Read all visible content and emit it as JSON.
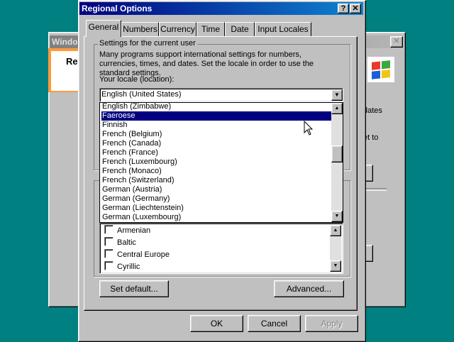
{
  "background_window": {
    "title": "Windo",
    "heading": "Re",
    "close_glyph": "✕",
    "side_text_1": "dates",
    "side_text_2": "et to"
  },
  "dialog": {
    "title": "Regional Options",
    "help_glyph": "?",
    "close_glyph": "✕"
  },
  "tabs": [
    {
      "label": "General",
      "active": true
    },
    {
      "label": "Numbers"
    },
    {
      "label": "Currency"
    },
    {
      "label": "Time"
    },
    {
      "label": "Date"
    },
    {
      "label": "Input Locales"
    }
  ],
  "settings_group": {
    "label": "Settings for the current user",
    "description": "Many programs support international settings for numbers, currencies, times, and dates. Set the locale in order to use the standard settings.",
    "locale_label": "Your locale (location):",
    "locale_value": "English (United States)"
  },
  "locale_dropdown": {
    "items": [
      "English (Zimbabwe)",
      "Faeroese",
      "Finnish",
      "French (Belgium)",
      "French (Canada)",
      "French (France)",
      "French (Luxembourg)",
      "French (Monaco)",
      "French (Switzerland)",
      "German (Austria)",
      "German (Germany)",
      "German (Liechtenstein)",
      "German (Luxembourg)"
    ],
    "selected": "Faeroese"
  },
  "language_groups": {
    "items": [
      "Armenian",
      "Baltic",
      "Central Europe",
      "Cyrillic"
    ]
  },
  "buttons": {
    "set_default": "Set default...",
    "advanced": "Advanced...",
    "ok": "OK",
    "cancel": "Cancel",
    "apply": "Apply"
  },
  "colors": {
    "desktop": "#008080",
    "titlebar_active": "#000080",
    "selection": "#000080",
    "face": "#c0c0c0"
  }
}
